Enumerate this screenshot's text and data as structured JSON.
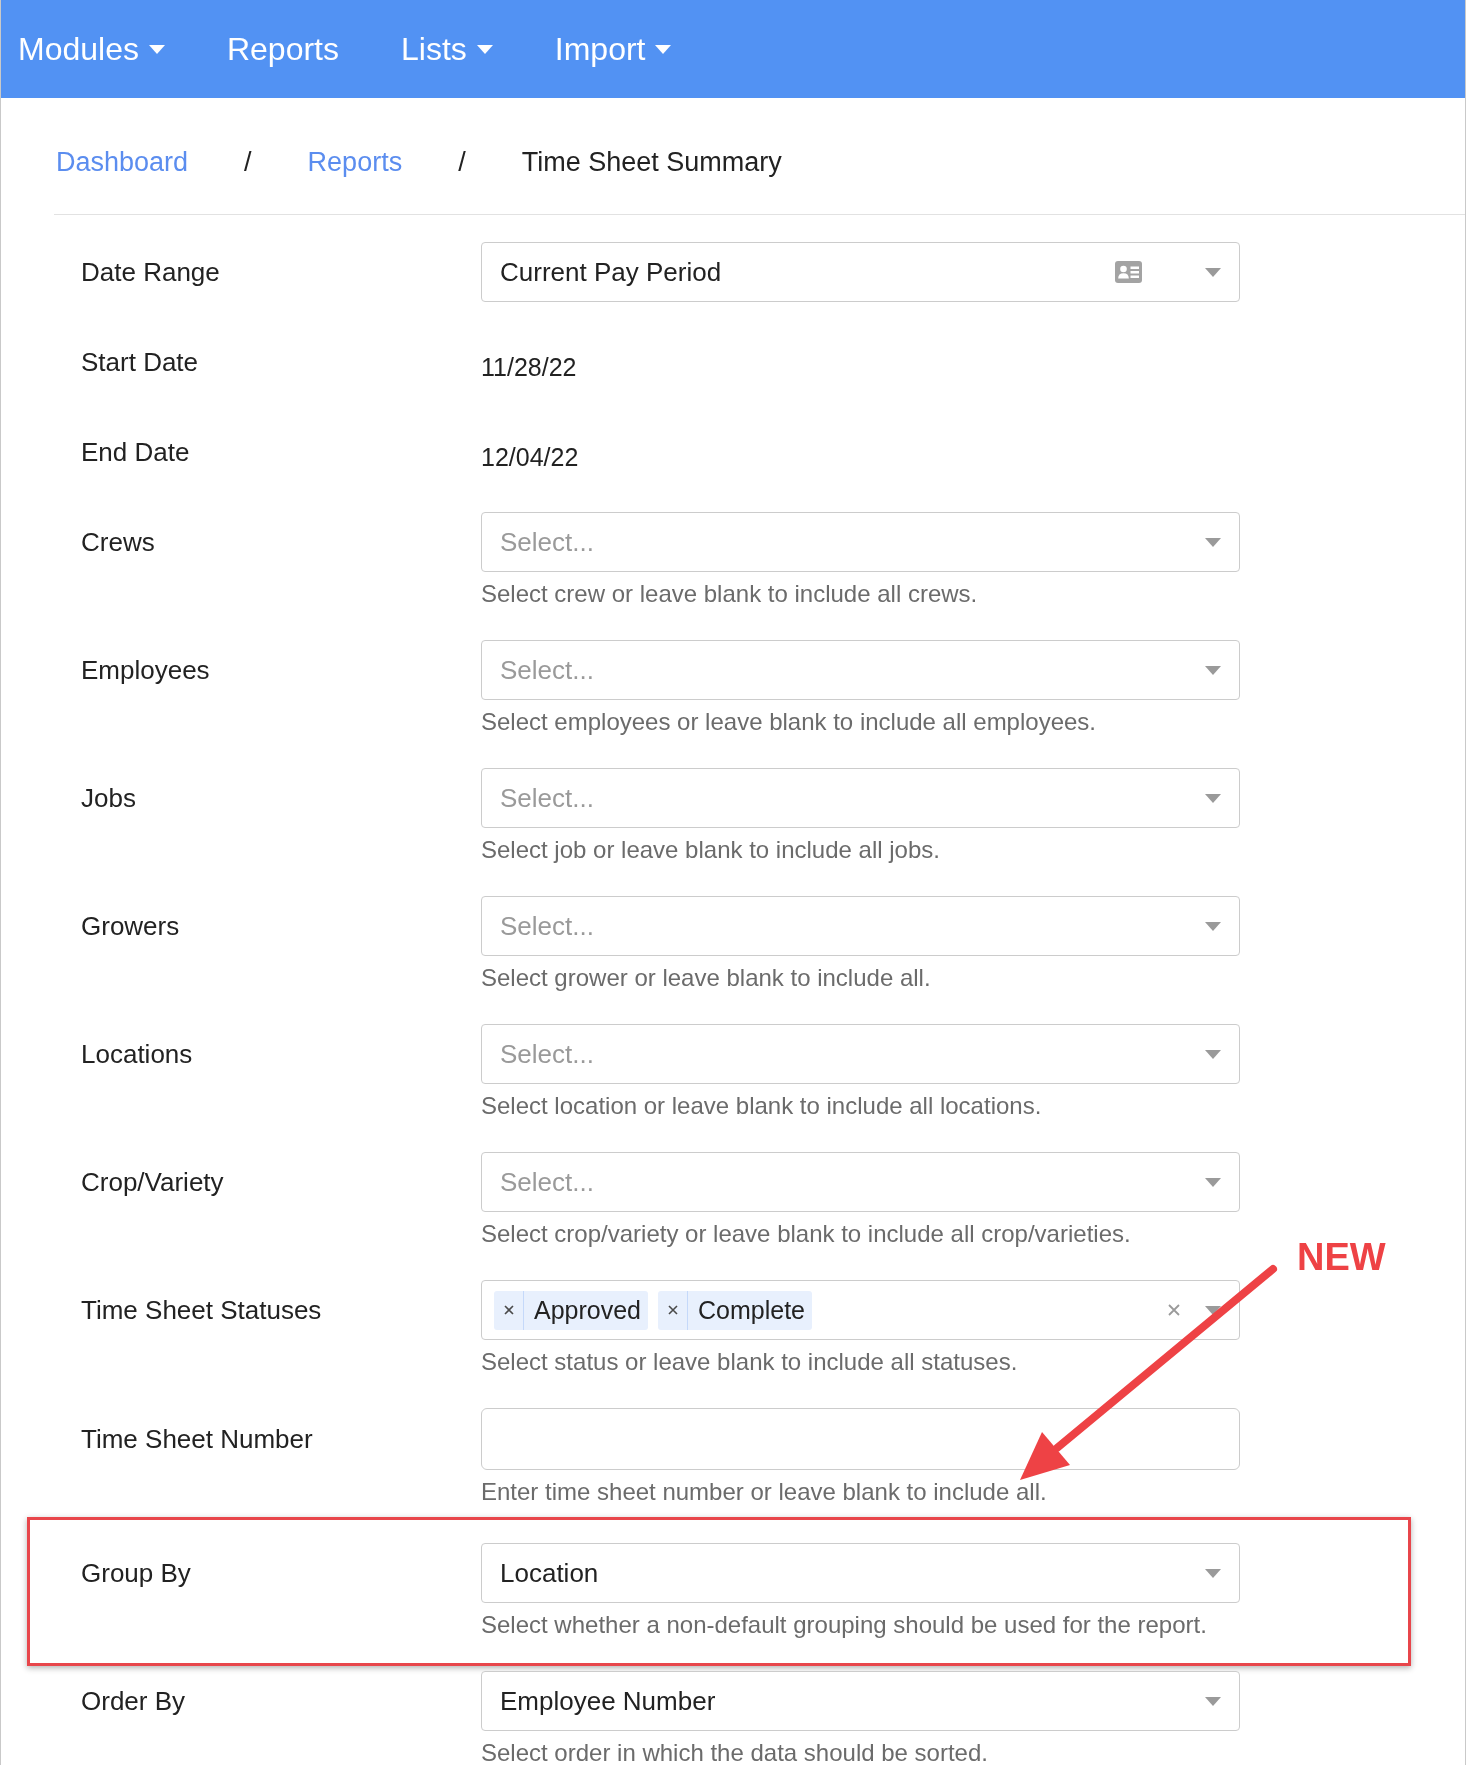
{
  "navbar": {
    "items": [
      {
        "label": "Modules",
        "dropdown": true
      },
      {
        "label": "Reports",
        "dropdown": false
      },
      {
        "label": "Lists",
        "dropdown": true
      },
      {
        "label": "Import",
        "dropdown": true
      }
    ]
  },
  "breadcrumb": [
    {
      "kind": "link",
      "text": "Dashboard"
    },
    {
      "kind": "separator",
      "text": "/"
    },
    {
      "kind": "link",
      "text": "Reports"
    },
    {
      "kind": "separator",
      "text": "/"
    },
    {
      "kind": "current",
      "text": "Time Sheet Summary"
    }
  ],
  "form": {
    "rows": [
      {
        "kind": "select",
        "label": "Date Range",
        "value": "Current Pay Period",
        "card_icon": true,
        "highlighted": false
      },
      {
        "kind": "static",
        "label": "Start Date",
        "value": "11/28/22",
        "highlighted": false
      },
      {
        "kind": "static",
        "label": "End Date",
        "value": "12/04/22",
        "highlighted": false
      },
      {
        "kind": "select",
        "label": "Crews",
        "placeholder": "Select...",
        "hint": "Select crew or leave blank to include all crews.",
        "card_icon": false,
        "highlighted": false
      },
      {
        "kind": "select",
        "label": "Employees",
        "placeholder": "Select...",
        "hint": "Select employees or leave blank to include all employees.",
        "card_icon": false,
        "highlighted": false
      },
      {
        "kind": "select",
        "label": "Jobs",
        "placeholder": "Select...",
        "hint": "Select job or leave blank to include all jobs.",
        "card_icon": false,
        "highlighted": false
      },
      {
        "kind": "select",
        "label": "Growers",
        "placeholder": "Select...",
        "hint": "Select grower or leave blank to include all.",
        "card_icon": false,
        "highlighted": false
      },
      {
        "kind": "select",
        "label": "Locations",
        "placeholder": "Select...",
        "hint": "Select location or leave blank to include all locations.",
        "card_icon": false,
        "highlighted": false
      },
      {
        "kind": "select",
        "label": "Crop/Variety",
        "placeholder": "Select...",
        "hint": "Select crop/variety or leave blank to include all crop/varieties.",
        "card_icon": false,
        "highlighted": false
      },
      {
        "kind": "multiselect",
        "label": "Time Sheet Statuses",
        "chips": [
          "Approved",
          "Complete"
        ],
        "hint": "Select status or leave blank to include all statuses.",
        "highlighted": false
      },
      {
        "kind": "input",
        "label": "Time Sheet Number",
        "hint": "Enter time sheet number or leave blank to include all.",
        "highlighted": false
      },
      {
        "kind": "select",
        "label": "Group By",
        "value": "Location",
        "hint": "Select whether a non-default grouping should be used for the report.",
        "card_icon": false,
        "highlighted": true
      },
      {
        "kind": "select",
        "label": "Order By",
        "value": "Employee Number",
        "hint": "Select order in which the data should be sorted.",
        "card_icon": false,
        "highlighted": false
      }
    ]
  },
  "annotation": {
    "label": "NEW"
  }
}
